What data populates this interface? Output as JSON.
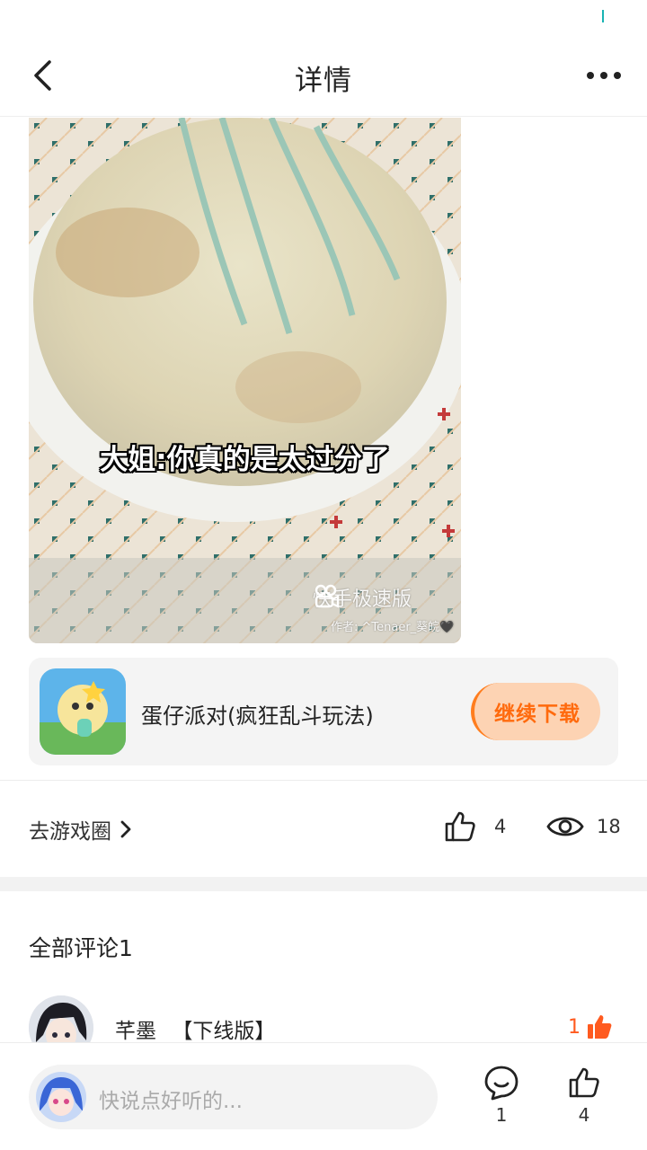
{
  "header": {
    "title": "详情",
    "back_icon": "chevron-left-icon",
    "more_icon": "more-horizontal-icon"
  },
  "media": {
    "subtitle": "大姐:你真的是太过分了",
    "watermark_brand": "快手极速版",
    "watermark_author": "作者: ^Tenaer_葵皖🖤"
  },
  "game": {
    "name": "蛋仔派对(疯狂乱斗玩法)",
    "button_label": "继续下载",
    "accent_color": "#ff6a0d"
  },
  "stats": {
    "circle_link": "去游戏圈",
    "likes": "4",
    "views": "18"
  },
  "comments": {
    "title": "全部评论1",
    "items": [
      {
        "user": "芊墨",
        "tag": "【下线版】",
        "likes": "1"
      }
    ]
  },
  "bottom": {
    "placeholder": "快说点好听的...",
    "comment_count": "1",
    "like_count": "4"
  }
}
